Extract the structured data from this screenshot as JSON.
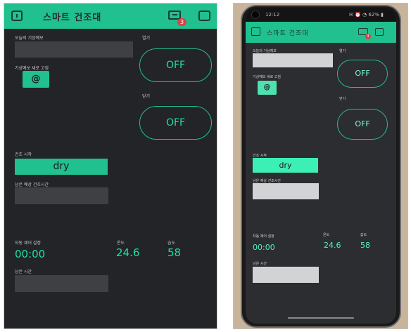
{
  "app": {
    "title": "스마트 건조대",
    "badge_count": "3",
    "colors": {
      "accent": "#20c08f",
      "background": "#232427",
      "text_value": "#20e0a0",
      "field": "#3f4043",
      "badge": "#d8434b"
    }
  },
  "labels": {
    "forecast": "오늘의 기상예보",
    "forecast_refresh": "기상예보 새로 고침",
    "open": "열기",
    "close": "닫기",
    "drying_start": "건조 시작",
    "remaining_estimate": "남은 예상 건조시간",
    "auto_control": "자동 제어 설정",
    "temperature": "온도",
    "humidity": "습도",
    "remaining_time": "남은 시간"
  },
  "buttons": {
    "refresh": "@",
    "open_toggle": "OFF",
    "close_toggle": "OFF",
    "dry": "dry"
  },
  "values": {
    "auto_time": "00:00",
    "temperature": "24.6",
    "humidity": "58"
  },
  "fields": {
    "forecast": "",
    "remaining_estimate": "",
    "remaining_time": ""
  },
  "phone": {
    "status_time": "12:12",
    "status_icons": "✉ ⏰ ◔ 62% ▮"
  },
  "icons": {
    "dashboard": "dashboard-icon",
    "device": "device-icon",
    "square": "square-icon"
  }
}
